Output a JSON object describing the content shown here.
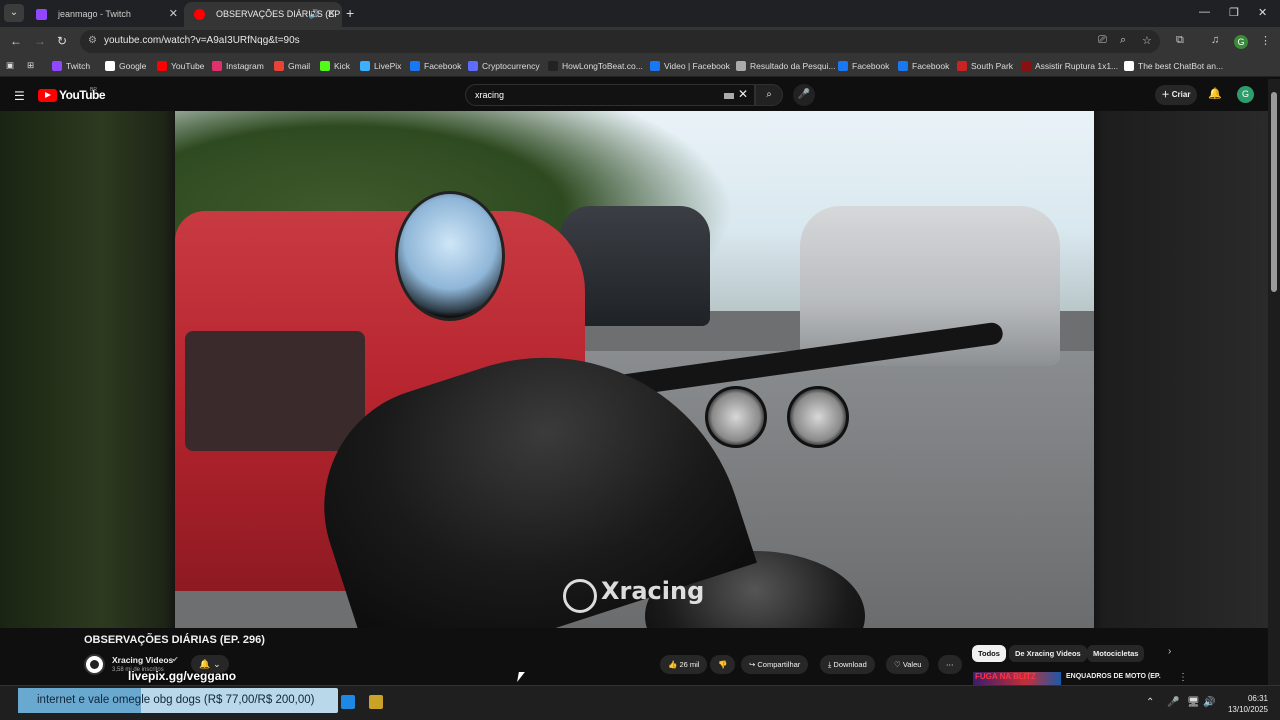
{
  "browser": {
    "tabs": [
      {
        "title": "jeanmago - Twitch",
        "favicon_color": "#9146ff"
      },
      {
        "title": "OBSERVAÇÕES DIÁRIAS (EP",
        "favicon_color": "#ff0000"
      }
    ],
    "new_tab": "+",
    "url": "youtube.com/watch?v=A9aI3URfNqg&t=90s",
    "profile_initial": "G"
  },
  "bookmarks": [
    {
      "label": "Twitch",
      "color": "#9146ff"
    },
    {
      "label": "Google",
      "color": "#ffffff"
    },
    {
      "label": "YouTube",
      "color": "#ff0000"
    },
    {
      "label": "Instagram",
      "color": "#e1306c"
    },
    {
      "label": "Gmail",
      "color": "#ea4335"
    },
    {
      "label": "Kick",
      "color": "#53fc18"
    },
    {
      "label": "LivePix",
      "color": "#3ab0ff"
    },
    {
      "label": "Facebook",
      "color": "#1877f2"
    },
    {
      "label": "Cryptocurrency",
      "color": "#5b6cff"
    },
    {
      "label": "HowLongToBeat.co...",
      "color": "#222222"
    },
    {
      "label": "Video | Facebook",
      "color": "#1877f2"
    },
    {
      "label": "Resultado da Pesqui...",
      "color": "#aaaaaa"
    },
    {
      "label": "Facebook",
      "color": "#1877f2"
    },
    {
      "label": "Facebook",
      "color": "#1877f2"
    },
    {
      "label": "South Park",
      "color": "#cc2222"
    },
    {
      "label": "Assistir Ruptura 1x1...",
      "color": "#8a1010"
    },
    {
      "label": "The best ChatBot an...",
      "color": "#ffffff"
    }
  ],
  "youtube": {
    "logo_text": "YouTube",
    "country_code": "BR",
    "search_query": "xracing",
    "create_label": "Criar",
    "avatar_initial": "G",
    "accent": "#ff0000"
  },
  "video": {
    "watermark": "Xracing",
    "title": "OBSERVAÇÕES DIÁRIAS (EP. 296)",
    "channel": "Xracing Videos",
    "subscribers": "3,58 mi de inscritos",
    "likes": "26 mil",
    "share_label": "Compartilhar",
    "download_label": "Download",
    "thanks_label": "Valeu"
  },
  "chips": [
    "Todos",
    "De Xracing Videos",
    "Motocicletas"
  ],
  "recommendation": {
    "thumb_text": "FUGA NA BLITZ",
    "title": "ENQUADROS DE MOTO (EP."
  },
  "overlay": {
    "livepix": "livepix.gg/veggano",
    "donation": "internet e vale omegle obg dogs (R$ 77,00/R$ 200,00)",
    "donation_progress": 0.385
  },
  "taskbar": {
    "time": "06:31",
    "date": "13/10/2025"
  }
}
